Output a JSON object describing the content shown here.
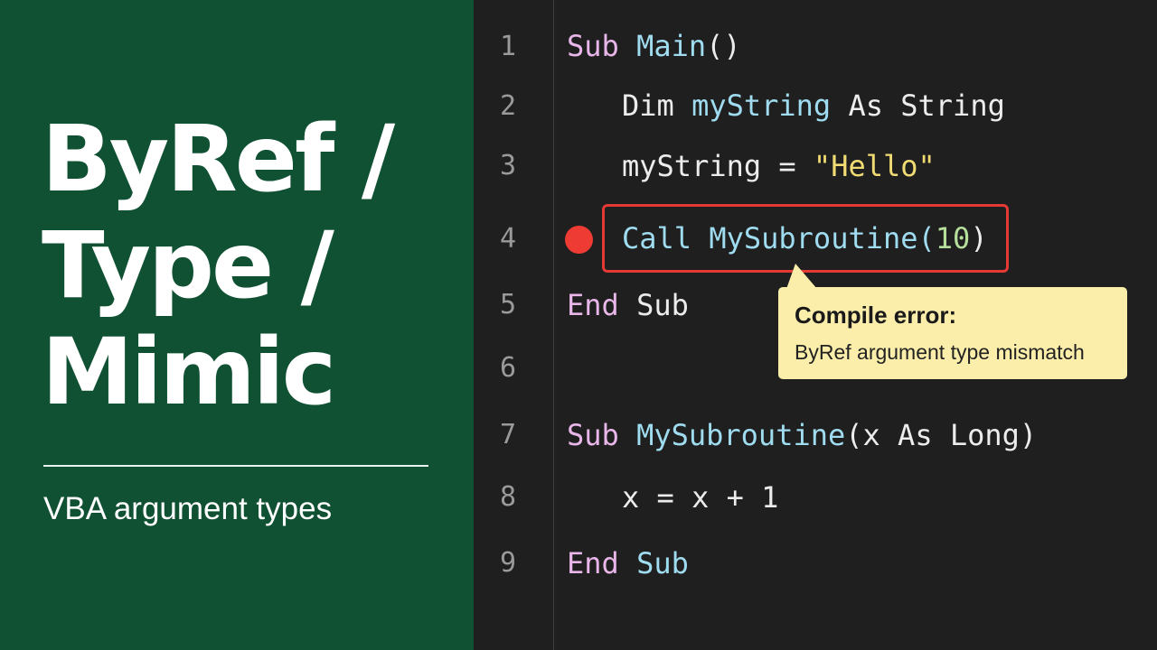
{
  "title": {
    "line1": "ByRef /",
    "line2": "Type /",
    "line3": "Mimic"
  },
  "subtitle": "VBA argument types",
  "editor": {
    "lines": [
      {
        "n": "1",
        "tokens": [
          "Sub",
          " ",
          "Main",
          "()"
        ]
      },
      {
        "n": "2",
        "tokens": [
          "Dim",
          " ",
          "myString",
          " As String"
        ]
      },
      {
        "n": "3",
        "tokens": [
          "myString = ",
          "\"Hello\""
        ]
      },
      {
        "n": "4",
        "tokens": [
          "Call MySubroutine(",
          "10",
          ")"
        ]
      },
      {
        "n": "5",
        "tokens": [
          "End",
          " Sub"
        ]
      },
      {
        "n": "6",
        "tokens": []
      },
      {
        "n": "7",
        "tokens": [
          "Sub",
          " ",
          "MySubroutine",
          "(x As Long)"
        ]
      },
      {
        "n": "8",
        "tokens": [
          "x = x + 1"
        ]
      },
      {
        "n": "9",
        "tokens": [
          "End",
          " ",
          "Sub"
        ]
      }
    ]
  },
  "tooltip": {
    "title": "Compile error:",
    "message": "ByRef argument type mismatch"
  },
  "colors": {
    "left_panel": "#0f5132",
    "editor_bg": "#1f1f1f",
    "keyword": "#e8b6e8",
    "identifier": "#9fdcf0",
    "string": "#f1dc73",
    "number": "#b5df9b",
    "error": "#e53935",
    "tooltip_bg": "#fbeeaa"
  },
  "icons": {
    "breakpoint": "breakpoint-dot-icon"
  }
}
